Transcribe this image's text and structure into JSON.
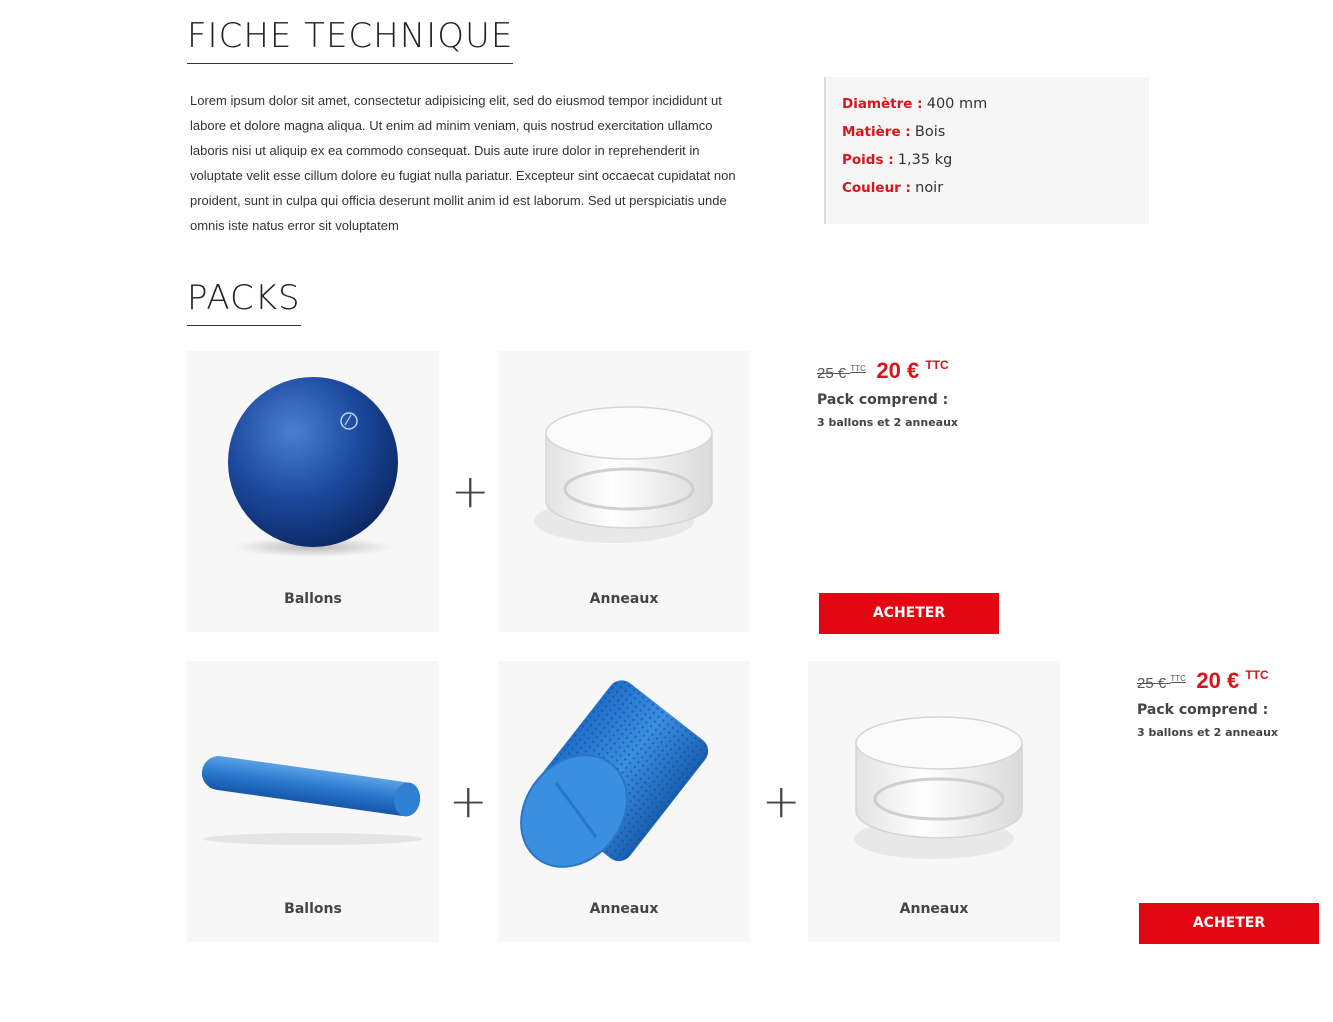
{
  "fiche": {
    "title": "FICHE TECHNIQUE",
    "description": "Lorem ipsum dolor sit amet, consectetur adipisicing elit, sed do eiusmod tempor incididunt ut labore et dolore magna aliqua. Ut enim ad minim veniam, quis nostrud exercitation ullamco laboris nisi ut aliquip ex ea commodo consequat. Duis aute irure dolor in reprehenderit in voluptate velit esse cillum dolore eu fugiat nulla pariatur. Excepteur sint occaecat cupidatat non proident, sunt in culpa qui officia deserunt mollit anim id est laborum. Sed ut perspiciatis unde omnis iste natus error sit voluptatem",
    "specs": [
      {
        "label": "Diamètre :",
        "value": "400 mm"
      },
      {
        "label": "Matière :",
        "value": "Bois"
      },
      {
        "label": "Poids :",
        "value": "1,35 kg"
      },
      {
        "label": "Couleur :",
        "value": "noir"
      }
    ]
  },
  "packs": {
    "title": "PACKS",
    "items": [
      {
        "products": [
          {
            "label": "Ballons",
            "image": "blue-pilates-ball"
          },
          {
            "label": "Anneaux",
            "image": "white-ring"
          }
        ],
        "plus": "+",
        "old_price": "25 €",
        "old_ttc": "TTC",
        "new_price": "20 €",
        "new_ttc": "TTC",
        "pack_title": "Pack comprend :",
        "pack_desc": "3 ballons et 2 anneaux",
        "button": "ACHETER"
      },
      {
        "products": [
          {
            "label": "Ballons",
            "image": "blue-foam-roller-long"
          },
          {
            "label": "Anneaux",
            "image": "blue-foam-roller-textured"
          },
          {
            "label": "Anneaux",
            "image": "white-ring"
          }
        ],
        "plus": "+",
        "old_price": "25 €",
        "old_ttc": "TTC",
        "new_price": "20 €",
        "new_ttc": "TTC",
        "pack_title": "Pack comprend :",
        "pack_desc": "3 ballons et 2 anneaux",
        "button": "ACHETER"
      }
    ]
  },
  "colors": {
    "accent": "#e30613",
    "label_red": "#d8151b",
    "card_bg": "#f7f7f7"
  }
}
